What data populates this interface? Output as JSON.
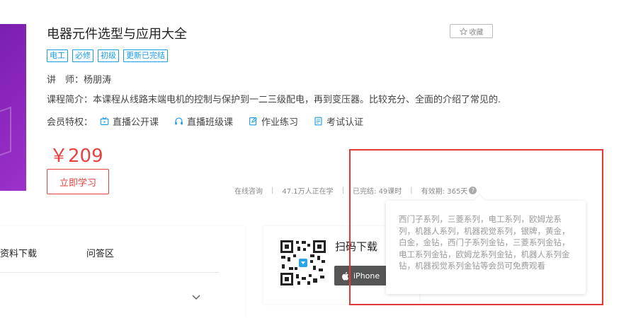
{
  "course": {
    "title": "电器元件选型与应用大全",
    "favorite_label": "收藏",
    "tags": [
      "电工",
      "必修",
      "初级",
      "更新已完结"
    ],
    "teacher_label": "讲　师：",
    "teacher_name": "杨朋涛",
    "intro_label": "课程简介：",
    "intro_text": "本课程从线路末端电机的控制与保护到一二三级配电，再到变压器。比较充分、全面的介绍了常见的...",
    "perks_label": "会员特权：",
    "perks": [
      {
        "label": "直播公开课",
        "icon": "live-tv-icon"
      },
      {
        "label": "直播班级课",
        "icon": "headset-icon"
      },
      {
        "label": "作业练习",
        "icon": "edit-note-icon"
      },
      {
        "label": "考试认证",
        "icon": "exam-doc-icon"
      }
    ],
    "price": "￥209",
    "study_button": "立即学习"
  },
  "stats": {
    "consult": "在线咨询",
    "learners": "47.1万人正在学",
    "completed": "已完结: 49课时",
    "validity": "有效期: 365天",
    "help_mark": "?"
  },
  "tabs": [
    "资料下载",
    "问答区"
  ],
  "qr_card": {
    "title": "扫码下载",
    "iphone_label": "iPhone"
  },
  "tooltip": {
    "text": "西门子系列，三菱系列，电工系列，欧姆龙系列，机器人系列，机器视觉系列，银牌，黄金，白金，金钻，西门子系列金钻，三菱系列金钻，电工系列金钻，欧姆龙系列金钻，机器人系列金钻，机器视觉系列金钻等会员可免费观看"
  },
  "colors": {
    "accent_blue": "#1a9be6",
    "price_red": "#e64340",
    "highlight_red": "#e53935",
    "cover_purple": "#8a25bd"
  }
}
